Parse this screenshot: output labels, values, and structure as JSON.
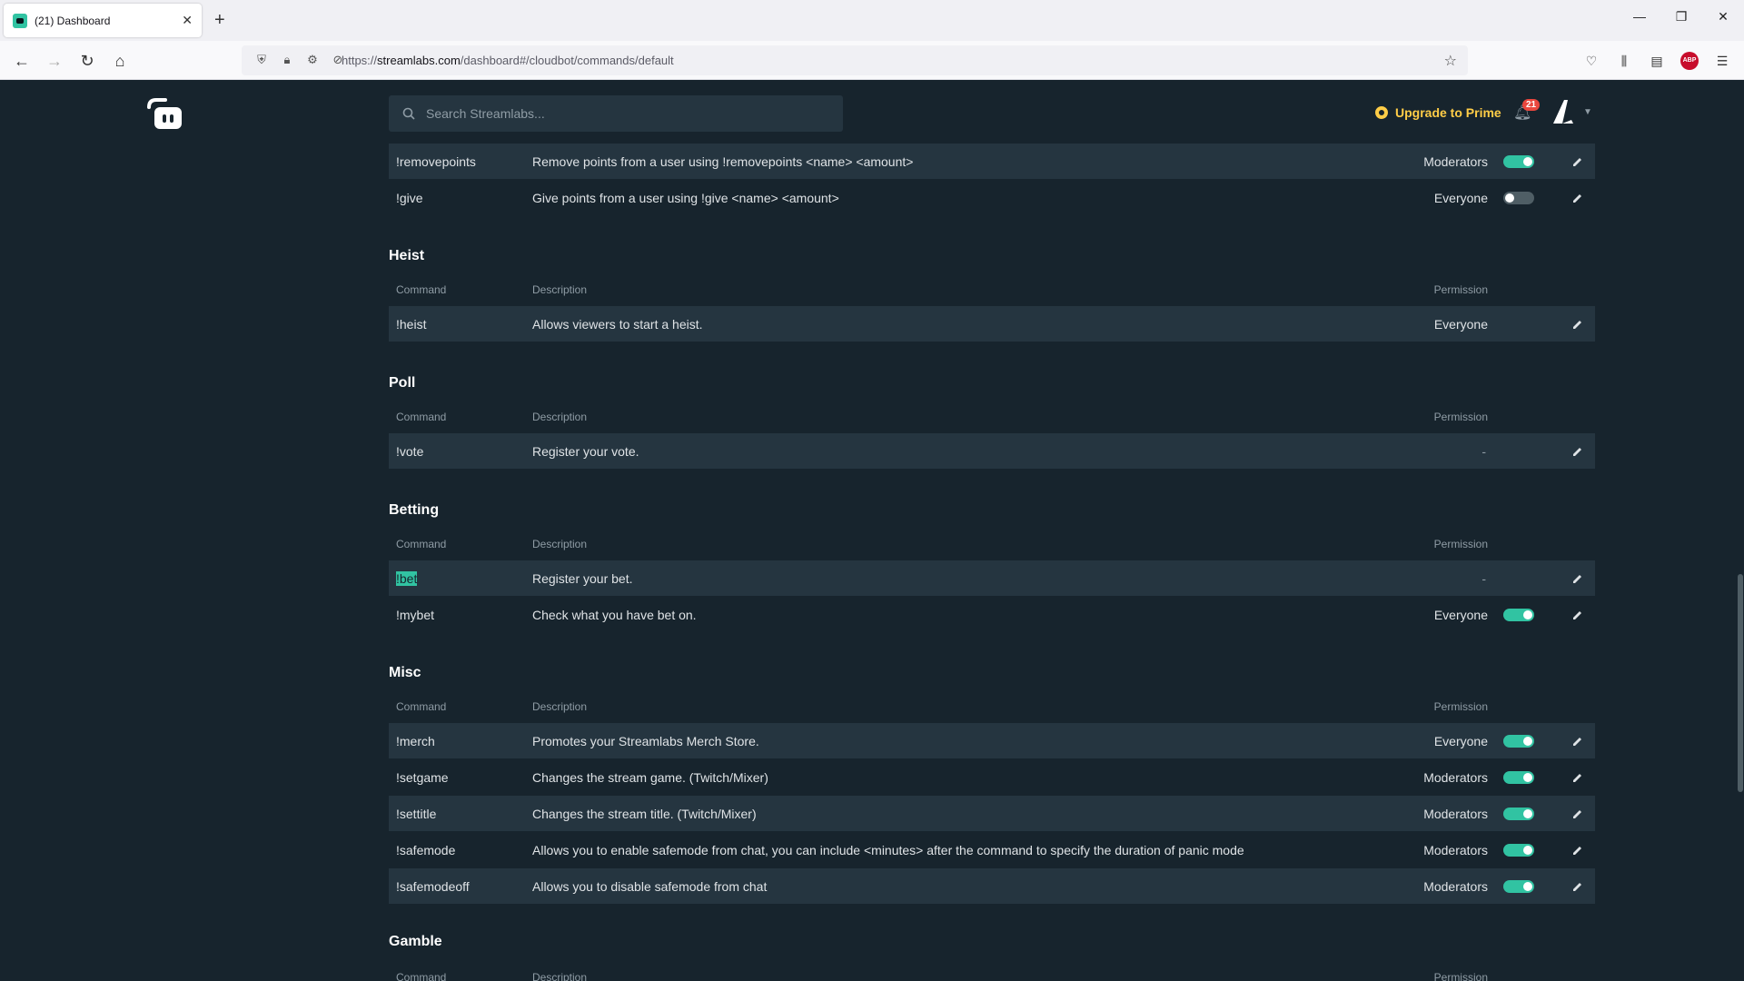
{
  "browser": {
    "tab_title": "(21) Dashboard",
    "url_host": "streamlabs.com",
    "url_path": "/dashboard#/cloudbot/commands/default",
    "url_scheme": "https://"
  },
  "header": {
    "search_placeholder": "Search Streamlabs...",
    "upgrade_label": "Upgrade to Prime",
    "notification_count": "21"
  },
  "columns": {
    "command": "Command",
    "description": "Description",
    "permission": "Permission"
  },
  "top_rows": [
    {
      "command": "!removepoints",
      "description": "Remove points from a user using !removepoints <name> <amount>",
      "permission": "Moderators",
      "toggle": "on"
    },
    {
      "command": "!give",
      "description": "Give points from a user using !give <name> <amount>",
      "permission": "Everyone",
      "toggle": "off"
    }
  ],
  "sections": [
    {
      "title": "Heist",
      "rows": [
        {
          "command": "!heist",
          "description": "Allows viewers to start a heist.",
          "permission": "Everyone"
        }
      ]
    },
    {
      "title": "Poll",
      "rows": [
        {
          "command": "!vote",
          "description": "Register your vote.",
          "permission": "-"
        }
      ]
    },
    {
      "title": "Betting",
      "rows": [
        {
          "command": "!bet",
          "description": "Register your bet.",
          "permission": "-"
        },
        {
          "command": "!mybet",
          "description": "Check what you have bet on.",
          "permission": "Everyone",
          "toggle": "on"
        }
      ]
    },
    {
      "title": "Misc",
      "rows": [
        {
          "command": "!merch",
          "description": "Promotes your Streamlabs Merch Store.",
          "permission": "Everyone",
          "toggle": "on"
        },
        {
          "command": "!setgame",
          "description": "Changes the stream game. (Twitch/Mixer)",
          "permission": "Moderators",
          "toggle": "on"
        },
        {
          "command": "!settitle",
          "description": "Changes the stream title. (Twitch/Mixer)",
          "permission": "Moderators",
          "toggle": "on"
        },
        {
          "command": "!safemode",
          "description": "Allows you to enable safemode from chat, you can include <minutes> after the command to specify the duration of panic mode",
          "permission": "Moderators",
          "toggle": "on"
        },
        {
          "command": "!safemodeoff",
          "description": "Allows you to disable safemode from chat",
          "permission": "Moderators",
          "toggle": "on"
        }
      ]
    },
    {
      "title": "Gamble",
      "rows": []
    }
  ],
  "colors": {
    "accent": "#31c3a2",
    "background": "#17242d",
    "row_shade": "#253540",
    "prime": "#ffcd47"
  }
}
